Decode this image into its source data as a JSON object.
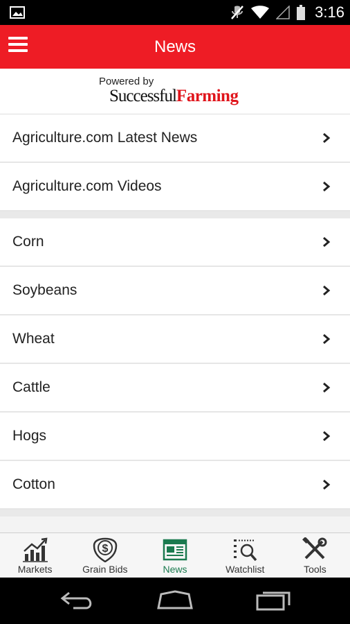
{
  "status_bar": {
    "time": "3:16",
    "icons": [
      "gallery-notification-icon",
      "mute-icon",
      "wifi-icon",
      "signal-icon",
      "battery-icon"
    ]
  },
  "app_bar": {
    "title": "News",
    "menu_icon": "hamburger-menu-icon",
    "background_color": "#ee1c25"
  },
  "brand_banner": {
    "powered_by": "Powered by",
    "brand_part1": "Successful",
    "brand_part2": "Farming"
  },
  "news_groups": [
    {
      "items": [
        {
          "label": "Agriculture.com Latest News"
        },
        {
          "label": "Agriculture.com Videos"
        }
      ]
    },
    {
      "items": [
        {
          "label": "Corn"
        },
        {
          "label": "Soybeans"
        },
        {
          "label": "Wheat"
        },
        {
          "label": "Cattle"
        },
        {
          "label": "Hogs"
        },
        {
          "label": "Cotton"
        }
      ]
    }
  ],
  "bottom_nav": {
    "active": "News",
    "active_color": "#1a7a4f",
    "items": [
      {
        "label": "Markets",
        "icon": "markets-chart-icon"
      },
      {
        "label": "Grain Bids",
        "icon": "grain-bids-dollar-icon"
      },
      {
        "label": "News",
        "icon": "newspaper-icon"
      },
      {
        "label": "Watchlist",
        "icon": "watchlist-search-icon"
      },
      {
        "label": "Tools",
        "icon": "tools-icon"
      }
    ]
  },
  "system_nav": {
    "icons": [
      "back-icon",
      "home-icon",
      "recent-apps-icon"
    ]
  }
}
